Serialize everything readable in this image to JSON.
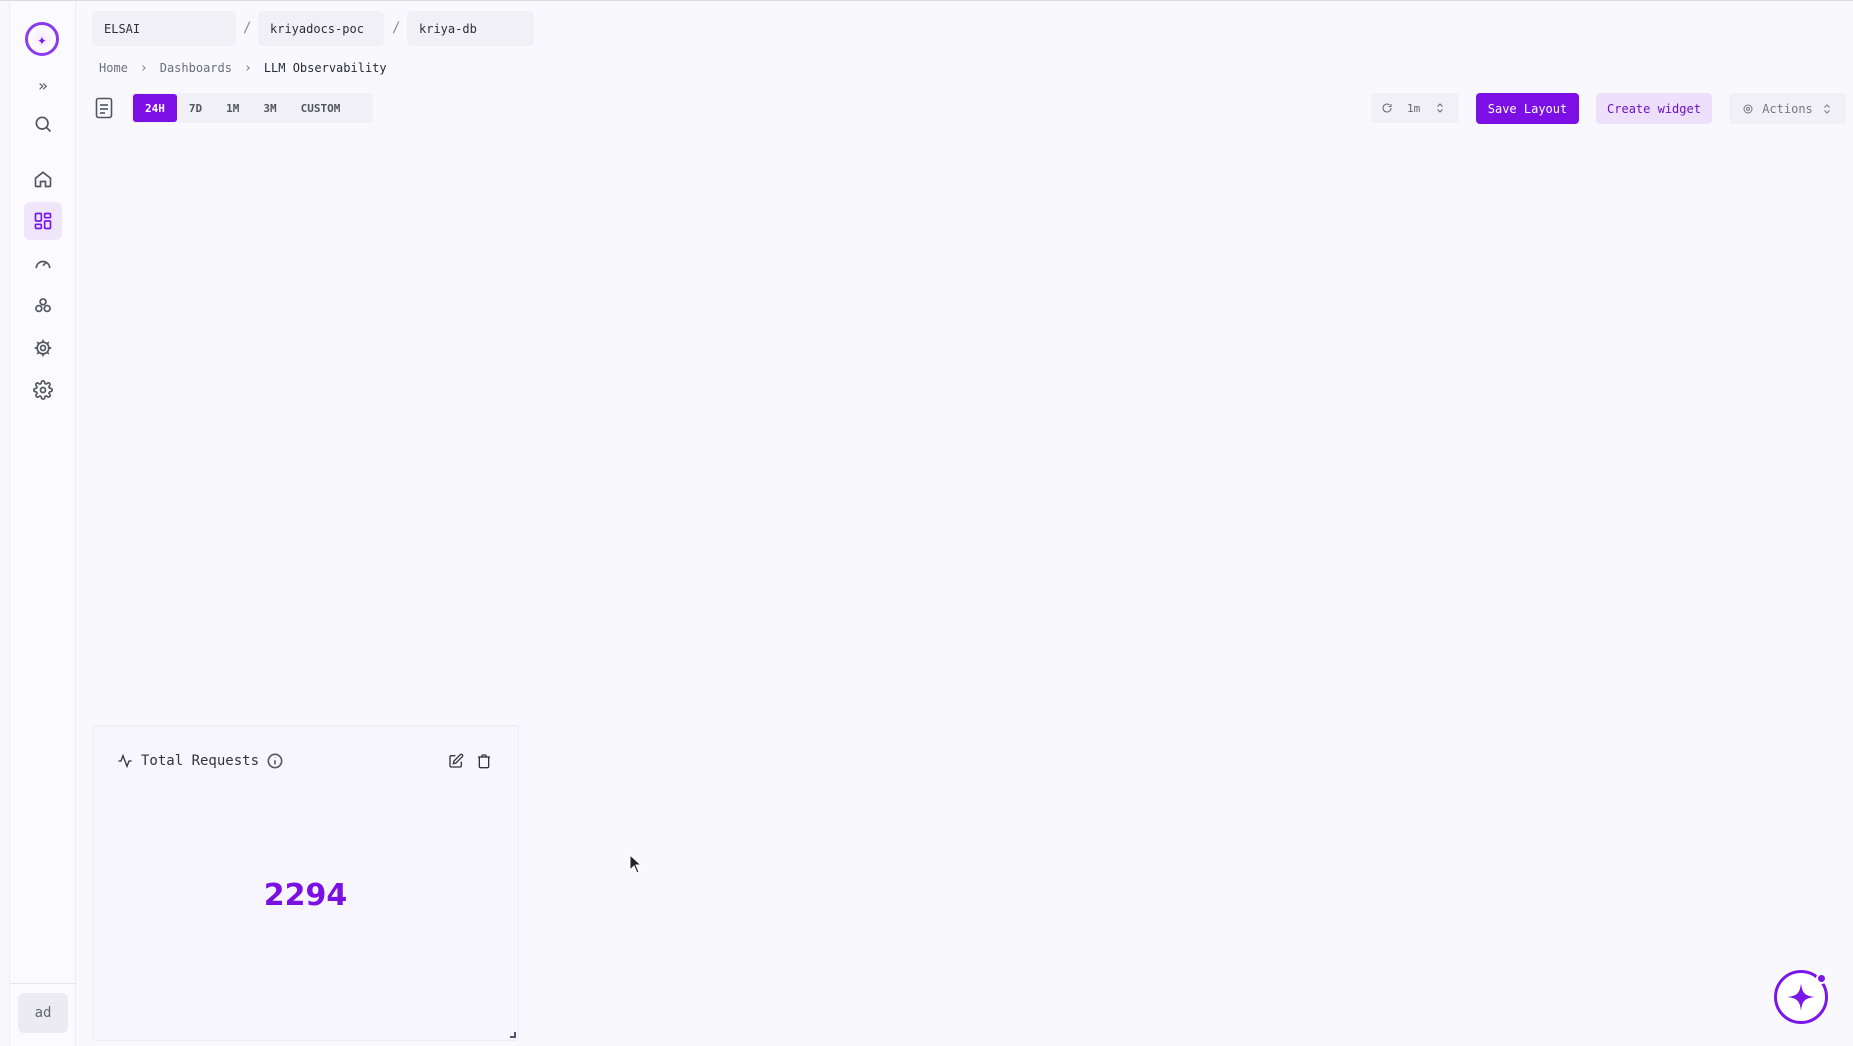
{
  "sidebar": {
    "logo_icon": "brand-logo-icon",
    "expand_label": "»",
    "avatar": "ad",
    "items": [
      {
        "name": "search",
        "icon": "search-icon"
      },
      {
        "name": "home",
        "icon": "home-icon"
      },
      {
        "name": "dashboards",
        "icon": "dashboard-grid-icon",
        "active": true
      },
      {
        "name": "monitoring",
        "icon": "gauge-icon"
      },
      {
        "name": "integrations",
        "icon": "cluster-icon"
      },
      {
        "name": "automation",
        "icon": "cog-icon"
      },
      {
        "name": "settings",
        "icon": "settings-icon"
      }
    ]
  },
  "context": {
    "org": "ELSAI",
    "project": "kriyadocs-poc",
    "database": "kriya-db",
    "separator": "/"
  },
  "breadcrumb": {
    "home": "Home",
    "dashboards": "Dashboards",
    "current": "LLM Observability",
    "separator": "›"
  },
  "time_range": {
    "options": [
      "24H",
      "7D",
      "1M",
      "3M",
      "CUSTOM"
    ],
    "selected": "24H"
  },
  "toolbar": {
    "refresh_interval": "1m",
    "save_label": "Save Layout",
    "create_label": "Create widget",
    "actions_label": "Actions"
  },
  "widget": {
    "title": "Total Requests",
    "value": "2294"
  },
  "colors": {
    "accent": "#7b0fe6",
    "accent_light": "#eedffc",
    "background": "#f9f8fd"
  }
}
